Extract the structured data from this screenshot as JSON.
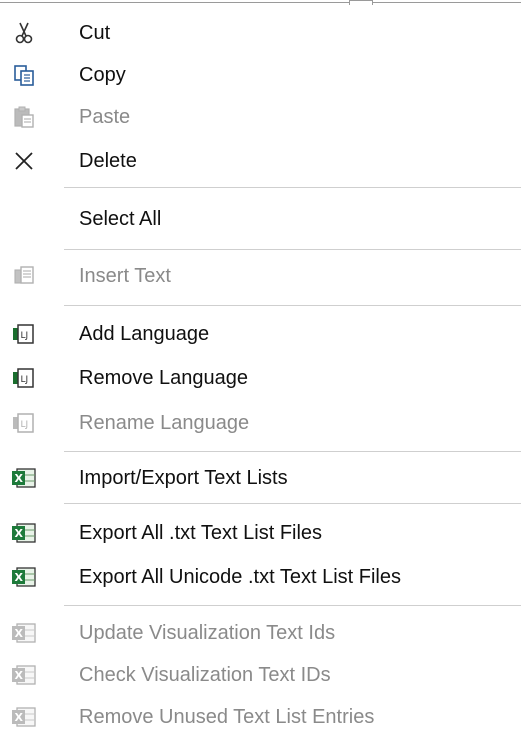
{
  "context_menu": {
    "items": [
      {
        "label": "Cut",
        "icon": "scissors-icon",
        "enabled": true
      },
      {
        "label": "Copy",
        "icon": "copy-icon",
        "enabled": true
      },
      {
        "label": "Paste",
        "icon": "paste-icon",
        "enabled": false
      },
      {
        "label": "Delete",
        "icon": "delete-x-icon",
        "enabled": true
      },
      {
        "label": "Select All",
        "icon": "",
        "enabled": true
      },
      {
        "label": "Insert Text",
        "icon": "insert-text-icon",
        "enabled": false
      },
      {
        "label": "Add Language",
        "icon": "language-icon",
        "enabled": true
      },
      {
        "label": "Remove Language",
        "icon": "language-icon",
        "enabled": true
      },
      {
        "label": "Rename Language",
        "icon": "language-icon",
        "enabled": false
      },
      {
        "label": "Import/Export Text Lists",
        "icon": "excel-icon",
        "enabled": true
      },
      {
        "label": "Export All .txt Text List Files",
        "icon": "excel-icon",
        "enabled": true
      },
      {
        "label": "Export All Unicode .txt Text List Files",
        "icon": "excel-icon",
        "enabled": true
      },
      {
        "label": "Update Visualization Text Ids",
        "icon": "excel-icon",
        "enabled": false
      },
      {
        "label": "Check Visualization Text IDs",
        "icon": "excel-icon",
        "enabled": false
      },
      {
        "label": "Remove Unused Text List Entries",
        "icon": "excel-icon",
        "enabled": false
      }
    ]
  }
}
